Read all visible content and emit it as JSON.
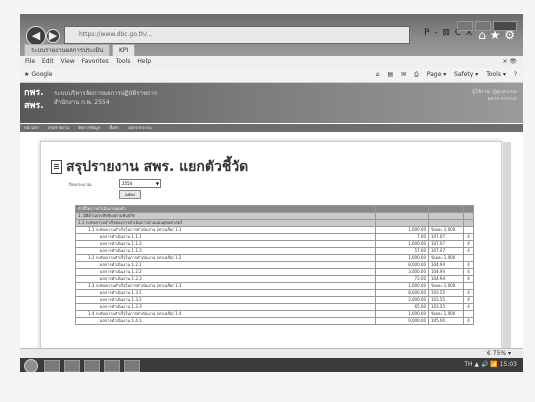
{
  "browser": {
    "address": "https://www.dbc.go.th/...",
    "tabs": [
      "ระบบรายงานผลการประเมิน",
      "KPI"
    ],
    "address_controls": "P - ⊠ C X",
    "home_icons": "⌂ ★ ⚙"
  },
  "menubar": {
    "items": [
      "File",
      "Edit",
      "View",
      "Favorites",
      "Tools",
      "Help"
    ],
    "zoom_corner": "× 👁"
  },
  "favbar": {
    "item": "Google",
    "commands": [
      "Page ▾",
      "Safety ▾",
      "Tools ▾",
      "?"
    ]
  },
  "site": {
    "logo_line1": "กพร.",
    "logo_line2": "สพร.",
    "title_line1": "ระบบบริหารจัดการผลการปฏิบัติราชการ",
    "title_line2": "สำนักงาน ก.พ. 2554",
    "right_line1": "ผู้ใช้งาน: ผู้ดูแลระบบ",
    "right_line2": "ออกจากระบบ",
    "nav": [
      "หน้าแรก",
      "สรุปรายงาน",
      "จัดการข้อมูล",
      "ตั้งค่า",
      "ออกจากระบบ"
    ]
  },
  "page": {
    "title": "สรุปรายงาน สพร. แยกตัวชี้วัด",
    "filter_label": "ปีงบประมาณ",
    "filter_value": "2554",
    "button": "แสดง"
  },
  "report": {
    "rows": [
      {
        "label": "ตัวชี้วัดการดำเนินงานทุกตัว",
        "value": "",
        "unit": "",
        "flag": "",
        "type": "head"
      },
      {
        "label": "1. มิติด้านประสิทธิผลตามพันธกิจ",
        "value": "",
        "unit": "",
        "flag": "",
        "type": "sub"
      },
      {
        "label": "1.1 ระดับความสำเร็จของการดำเนินการตามแผนยุทธศาสตร์",
        "value": "",
        "unit": "",
        "flag": "",
        "type": "sub"
      },
      {
        "label": "1.1 ระดับความสำเร็จในการดำเนินงาน (ค่าเฉลี่ย) 1.1",
        "value": "1,000.00",
        "unit": "ร้อยละ 1,000",
        "flag": "",
        "type": "row"
      },
      {
        "label": "ผลการดำเนินงาน 1.1.1",
        "value": "7.00",
        "unit": "107.07",
        "flag": "4",
        "type": "row"
      },
      {
        "label": "ผลการดำเนินงาน 1.1.2",
        "value": "1,000.00",
        "unit": "107.07",
        "flag": "4",
        "type": "row"
      },
      {
        "label": "ผลการดำเนินงาน 1.1.3",
        "value": "57.00",
        "unit": "107.07",
        "flag": "4",
        "type": "row"
      },
      {
        "label": "1.2 ระดับความสำเร็จในการดำเนินงาน (ค่าเฉลี่ย) 1.2",
        "value": "1,000.00",
        "unit": "ร้อยละ 1,000",
        "flag": "",
        "type": "row"
      },
      {
        "label": "ผลการดำเนินงาน 1.2.1",
        "value": "8,000.00",
        "unit": "104.94",
        "flag": "4",
        "type": "row"
      },
      {
        "label": "ผลการดำเนินงาน 1.2.2",
        "value": "3,000.00",
        "unit": "104.94",
        "flag": "4",
        "type": "row"
      },
      {
        "label": "ผลการดำเนินงาน 1.2.3",
        "value": "73.00",
        "unit": "104.94",
        "flag": "4",
        "type": "row"
      },
      {
        "label": "1.3 ระดับความสำเร็จในการดำเนินงาน (ค่าเฉลี่ย) 1.3",
        "value": "1,000.00",
        "unit": "ร้อยละ 1,000",
        "flag": "",
        "type": "row"
      },
      {
        "label": "ผลการดำเนินงาน 1.3.1",
        "value": "8,000.00",
        "unit": "103.55",
        "flag": "4",
        "type": "row"
      },
      {
        "label": "ผลการดำเนินงาน 1.3.2",
        "value": "2,000.00",
        "unit": "103.55",
        "flag": "4",
        "type": "row"
      },
      {
        "label": "ผลการดำเนินงาน 1.3.3",
        "value": "65.00",
        "unit": "103.55",
        "flag": "4",
        "type": "row"
      },
      {
        "label": "1.4 ระดับความสำเร็จในการดำเนินงาน (ค่าเฉลี่ย) 1.4",
        "value": "1,000.00",
        "unit": "ร้อยละ 1,000",
        "flag": "",
        "type": "row"
      },
      {
        "label": "ผลการดำเนินงาน 1.4.1",
        "value": "9,000.00",
        "unit": "105.00",
        "flag": "4",
        "type": "row"
      }
    ]
  },
  "status": {
    "zoom": "€ 75%  ▾"
  },
  "taskbar": {
    "tray": "TH ▲ 🔊 📶 15:03"
  }
}
